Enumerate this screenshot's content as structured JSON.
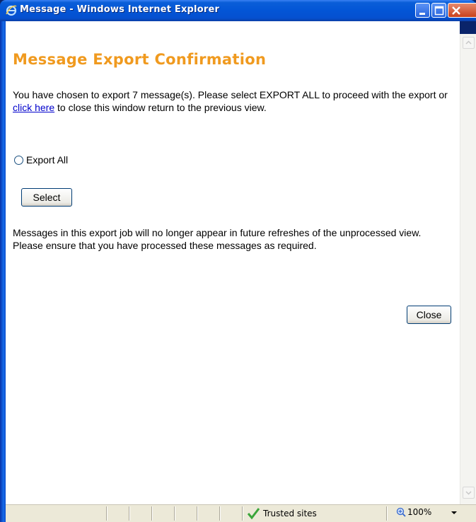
{
  "window": {
    "title": "Message - Windows Internet Explorer"
  },
  "page": {
    "heading": "Message Export Confirmation",
    "intro_before_link": "You have chosen to export 7 message(s). Please select EXPORT ALL to proceed with the export or ",
    "intro_link": "click here",
    "intro_after_link": " to close this window return to the previous view.",
    "radio_label": "Export All",
    "select_button": "Select",
    "notice": "Messages in this export job will no longer appear in future refreshes of the unprocessed view. Please ensure that you have processed these messages as required.",
    "close_button": "Close"
  },
  "statusbar": {
    "zone": "Trusted sites",
    "zoom": "100%"
  },
  "colors": {
    "heading": "#f09a1f",
    "link": "#0000cc",
    "titlebar": "#0355d6"
  }
}
